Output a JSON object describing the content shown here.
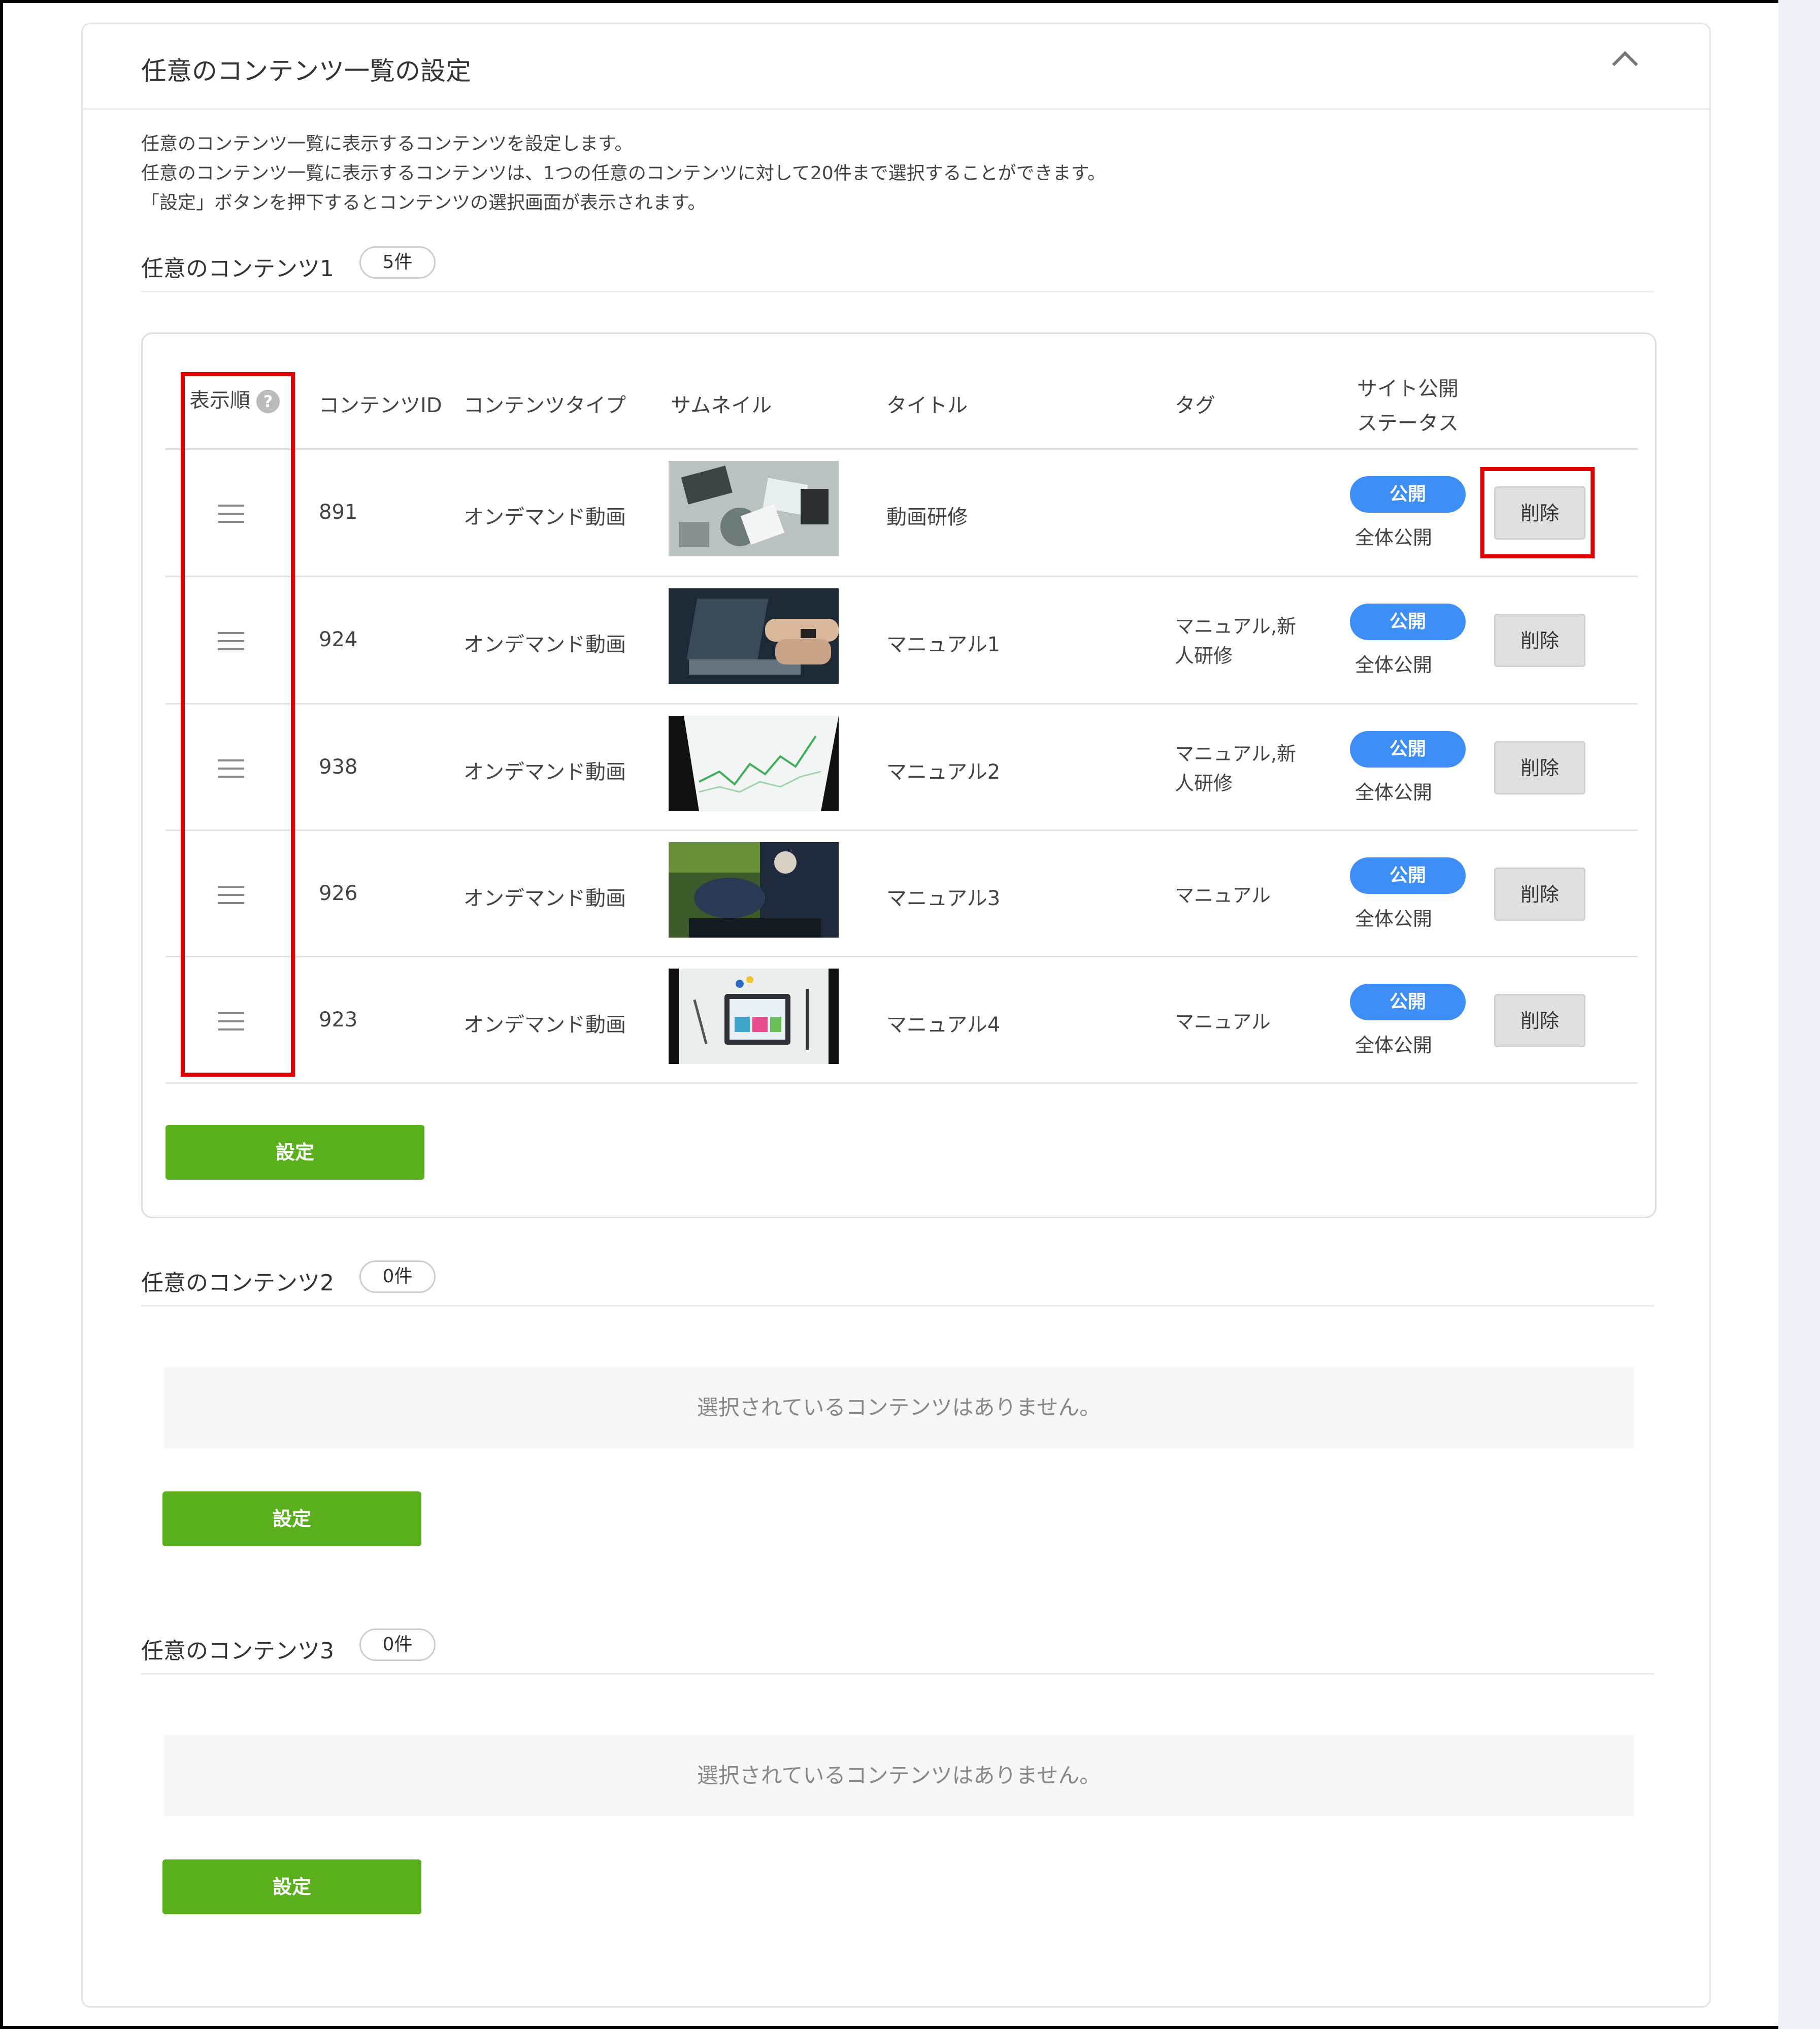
{
  "section": {
    "title": "任意のコンテンツ一覧の設定",
    "description": [
      "任意のコンテンツ一覧に表示するコンテンツを設定します。",
      "任意のコンテンツ一覧に表示するコンテンツは、1つの任意のコンテンツに対して20件まで選択することができます。",
      "「設定」ボタンを押下するとコンテンツの選択画面が表示されます。"
    ]
  },
  "table_headers": {
    "order": "表示順",
    "help": "?",
    "id": "コンテンツID",
    "type": "コンテンツタイプ",
    "thumbnail": "サムネイル",
    "title": "タイトル",
    "tag": "タグ",
    "status_line1": "サイト公開",
    "status_line2": "ステータス"
  },
  "groups": [
    {
      "title": "任意のコンテンツ1",
      "count": "5件",
      "rows": [
        {
          "id": "891",
          "type": "オンデマンド動画",
          "title": "動画研修",
          "tag_line1": "",
          "tag_line2": "",
          "status": "公開",
          "visibility": "全体公開",
          "delete": "削除"
        },
        {
          "id": "924",
          "type": "オンデマンド動画",
          "title": "マニュアル1",
          "tag_line1": "マニュアル,新",
          "tag_line2": "人研修",
          "status": "公開",
          "visibility": "全体公開",
          "delete": "削除"
        },
        {
          "id": "938",
          "type": "オンデマンド動画",
          "title": "マニュアル2",
          "tag_line1": "マニュアル,新",
          "tag_line2": "人研修",
          "status": "公開",
          "visibility": "全体公開",
          "delete": "削除"
        },
        {
          "id": "926",
          "type": "オンデマンド動画",
          "title": "マニュアル3",
          "tag_line1": "マニュアル",
          "tag_line2": "",
          "status": "公開",
          "visibility": "全体公開",
          "delete": "削除"
        },
        {
          "id": "923",
          "type": "オンデマンド動画",
          "title": "マニュアル4",
          "tag_line1": "マニュアル",
          "tag_line2": "",
          "status": "公開",
          "visibility": "全体公開",
          "delete": "削除"
        }
      ],
      "set_button": "設定"
    },
    {
      "title": "任意のコンテンツ2",
      "count": "0件",
      "empty_message": "選択されているコンテンツはありません。",
      "set_button": "設定"
    },
    {
      "title": "任意のコンテンツ3",
      "count": "0件",
      "empty_message": "選択されているコンテンツはありません。",
      "set_button": "設定"
    }
  ],
  "colors": {
    "accent_green": "#5ab01c",
    "status_blue": "#3d8ef7",
    "highlight_red": "#e00000"
  }
}
